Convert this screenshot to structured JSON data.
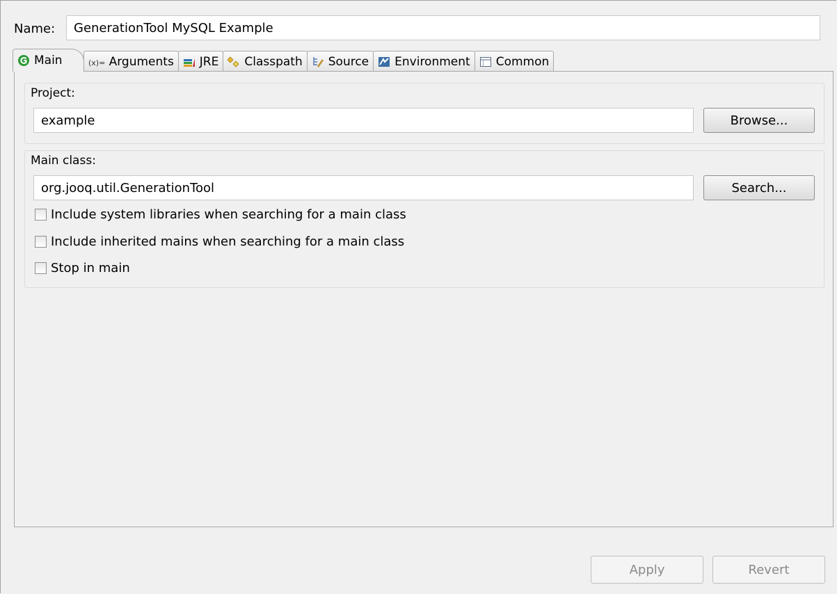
{
  "name": {
    "label": "Name:",
    "value": "GenerationTool MySQL Example"
  },
  "tabs": [
    {
      "label": "Main",
      "icon": "main-class-icon"
    },
    {
      "label": "Arguments",
      "icon": "arguments-icon"
    },
    {
      "label": "JRE",
      "icon": "jre-icon"
    },
    {
      "label": "Classpath",
      "icon": "classpath-icon"
    },
    {
      "label": "Source",
      "icon": "source-icon"
    },
    {
      "label": "Environment",
      "icon": "environment-icon"
    },
    {
      "label": "Common",
      "icon": "common-icon"
    }
  ],
  "project": {
    "label": "Project:",
    "value": "example",
    "button": "Browse..."
  },
  "main_class": {
    "label": "Main class:",
    "value": "org.jooq.util.GenerationTool",
    "button": "Search...",
    "options": [
      {
        "label": "Include system libraries when searching for a main class",
        "checked": false
      },
      {
        "label": "Include inherited mains when searching for a main class",
        "checked": false
      },
      {
        "label": "Stop in main",
        "checked": false
      }
    ]
  },
  "footer": {
    "apply": "Apply",
    "revert": "Revert"
  },
  "colors": {
    "main_icon": "#2e9b3a",
    "environment_icon": "#3a6ea5"
  }
}
